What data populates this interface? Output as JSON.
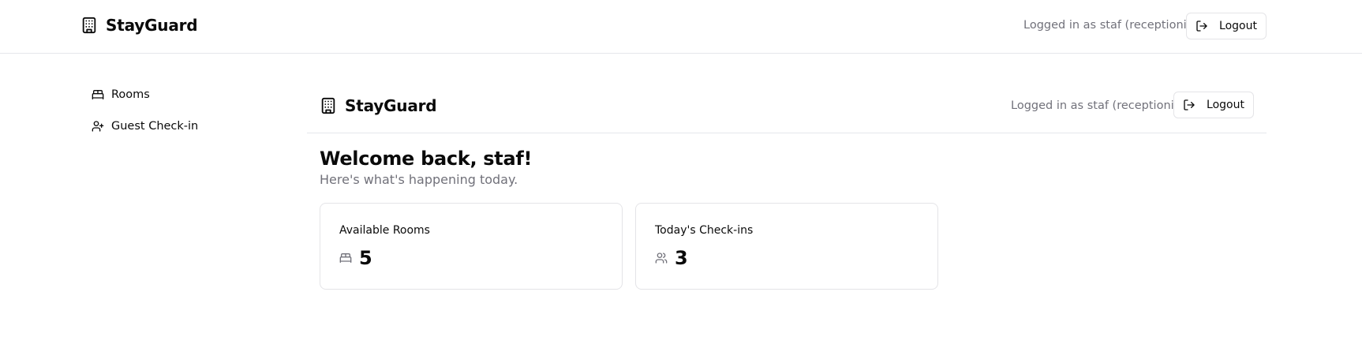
{
  "app": {
    "name": "StayGuard"
  },
  "header": {
    "logged_in_text": "Logged in as staf (receptionist)",
    "logout_label": "Logout"
  },
  "sidebar": {
    "items": [
      {
        "label": "Rooms",
        "icon": "bed-icon"
      },
      {
        "label": "Guest Check-in",
        "icon": "user-plus-icon"
      }
    ]
  },
  "main": {
    "header": {
      "title": "StayGuard",
      "logged_in_text": "Logged in as staf (receptionist)",
      "logout_label": "Logout"
    },
    "welcome_title": "Welcome back, staf!",
    "welcome_subtitle": "Here's what's happening today.",
    "stats": [
      {
        "label": "Available Rooms",
        "value": "5",
        "icon": "bed-icon"
      },
      {
        "label": "Today's Check-ins",
        "value": "3",
        "icon": "users-icon"
      }
    ]
  }
}
